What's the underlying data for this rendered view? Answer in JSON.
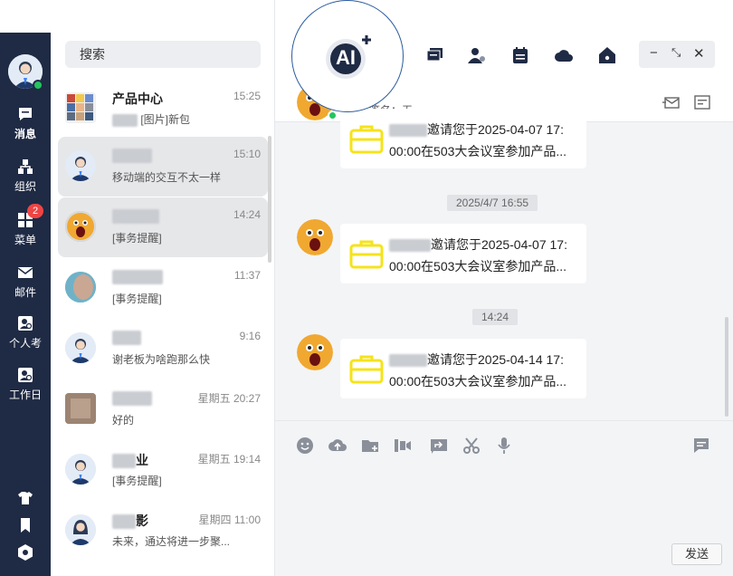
{
  "nav": {
    "items": [
      {
        "label": "消息",
        "icon": "chat-icon"
      },
      {
        "label": "组织",
        "icon": "org-icon"
      },
      {
        "label": "菜单",
        "icon": "grid-icon",
        "badge": "2"
      },
      {
        "label": "邮件",
        "icon": "mail-icon"
      },
      {
        "label": "个人考",
        "icon": "person-card-icon"
      },
      {
        "label": "工作日",
        "icon": "workday-icon"
      }
    ]
  },
  "search": {
    "placeholder": "搜索"
  },
  "conversations": [
    {
      "name": "产品中心",
      "time": "15:25",
      "preview": "[图片]新包"
    },
    {
      "name": "",
      "time": "15:10",
      "preview": "移动端的交互不太一样"
    },
    {
      "name": "",
      "time": "14:24",
      "preview": "[事务提醒]"
    },
    {
      "name": "",
      "time": "11:37",
      "preview": "[事务提醒]"
    },
    {
      "name": "",
      "time": "9:16",
      "preview": "谢老板为啥跑那么快"
    },
    {
      "name": "",
      "time": "星期五 20:27",
      "preview": "好的"
    },
    {
      "name": "业",
      "time": "星期五 19:14",
      "preview": "[事务提醒]"
    },
    {
      "name": "影",
      "time": "星期四 11:00",
      "preview": "未来，通达将进一步聚..."
    }
  ],
  "header": {
    "signature": "个性签名：无"
  },
  "ai": {
    "label": "AI"
  },
  "window": {
    "minimize": "−",
    "maximize": "⤡",
    "close": "✕"
  },
  "messages": [
    {
      "line1": "邀请您于2025-04-07 17:",
      "line2": "00:00在503大会议室参加产品..."
    },
    {
      "stamp": "2025/4/7 16:55"
    },
    {
      "line1": "邀请您于2025-04-07 17:",
      "line2": "00:00在503大会议室参加产品..."
    },
    {
      "stamp": "14:24"
    },
    {
      "line1": "邀请您于2025-04-14 17:",
      "line2": "00:00在503大会议室参加产品..."
    }
  ],
  "composer": {
    "send_label": "发送"
  },
  "colors": {
    "nav_bg": "#1f2a44",
    "online": "#22c55e",
    "badge": "#ef4444",
    "bag": "#f5e31a",
    "ai_border": "#2c5b9e"
  }
}
